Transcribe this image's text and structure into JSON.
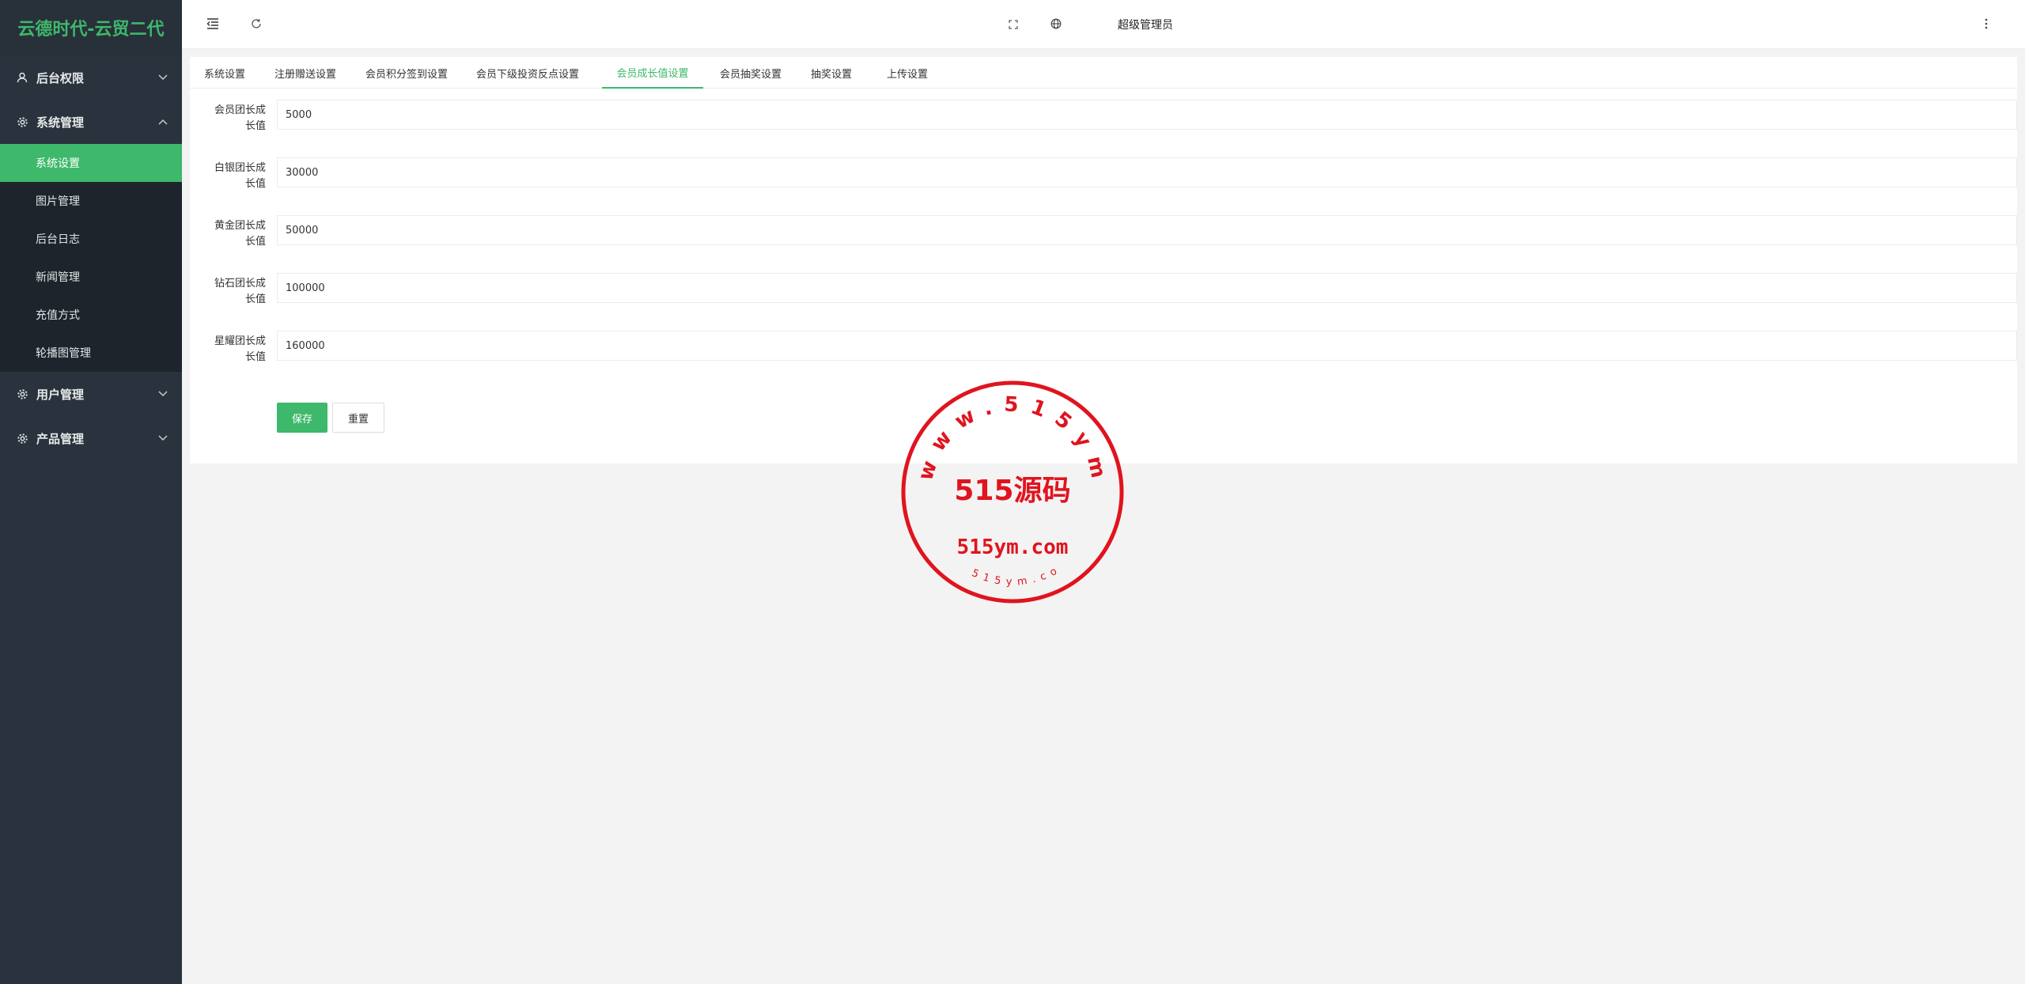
{
  "sidebar": {
    "logo": "云德时代-云贸二代",
    "groups": [
      {
        "label": "后台权限"
      },
      {
        "label": "系统管理"
      },
      {
        "label": "用户管理"
      },
      {
        "label": "产品管理"
      }
    ],
    "sub_items": [
      {
        "label": "系统设置"
      },
      {
        "label": "图片管理"
      },
      {
        "label": "后台日志"
      },
      {
        "label": "新闻管理"
      },
      {
        "label": "充值方式"
      },
      {
        "label": "轮播图管理"
      }
    ]
  },
  "header": {
    "admin_name": "超级管理员"
  },
  "tabs": [
    {
      "label": "系统设置"
    },
    {
      "label": "注册赠送设置"
    },
    {
      "label": "会员积分签到设置"
    },
    {
      "label": "会员下级投资反点设置"
    },
    {
      "label": "会员成长值设置"
    },
    {
      "label": "会员抽奖设置"
    },
    {
      "label": "抽奖设置"
    },
    {
      "label": "上传设置"
    }
  ],
  "form": {
    "fields": [
      {
        "label_line1": "会员团长成",
        "label_line2": "长值",
        "value": "5000"
      },
      {
        "label_line1": "白银团长成",
        "label_line2": "长值",
        "value": "30000"
      },
      {
        "label_line1": "黄金团长成",
        "label_line2": "长值",
        "value": "50000"
      },
      {
        "label_line1": "钻石团长成",
        "label_line2": "长值",
        "value": "100000"
      },
      {
        "label_line1": "星耀团长成",
        "label_line2": "长值",
        "value": "160000"
      }
    ],
    "save_label": "保存",
    "reset_label": "重置"
  },
  "watermark": {
    "ring_text": "www.515ym.com",
    "main_text": "515源码",
    "domain_text": "515ym.com",
    "bottom_text": "515ym.com"
  },
  "colors": {
    "accent": "#3eb86b",
    "sidebar_bg": "#2a333d",
    "stamp_red": "#e0141e"
  }
}
